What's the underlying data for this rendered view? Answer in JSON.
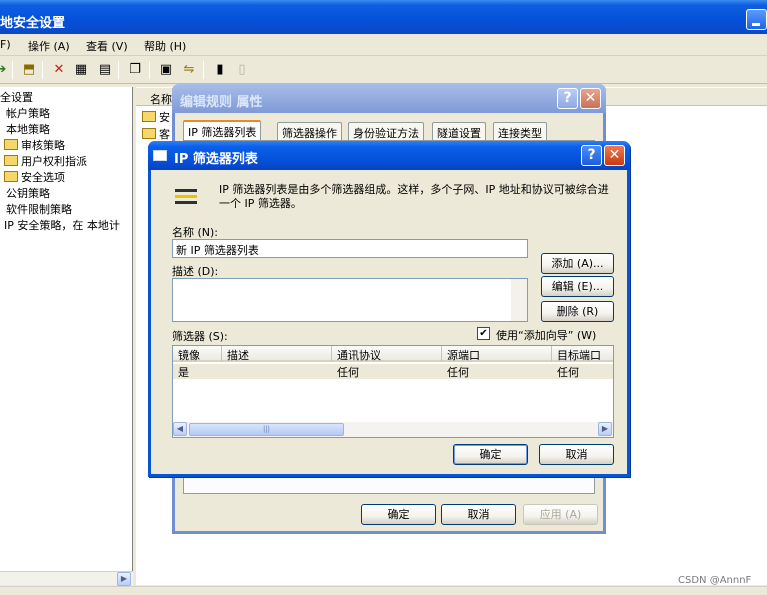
{
  "main_window": {
    "title": "地安全设置",
    "menu": [
      "F)",
      "操作 (A)",
      "查看 (V)",
      "帮助 (H)"
    ]
  },
  "tree": {
    "items": [
      {
        "label": "全设置"
      },
      {
        "label": "帐户策略"
      },
      {
        "label": "本地策略"
      },
      {
        "label": "审核策略"
      },
      {
        "label": "用户权利指派"
      },
      {
        "label": "安全选项"
      },
      {
        "label": "公钥策略"
      },
      {
        "label": "软件限制策略"
      },
      {
        "label": "IP 安全策略，在 本地计"
      }
    ]
  },
  "right_pane": {
    "header": "名称",
    "rows": [
      "安",
      "客"
    ]
  },
  "rule_dialog": {
    "title": "编辑规则 属性",
    "tabs": [
      "IP 筛选器列表",
      "筛选器操作",
      "身份验证方法",
      "隧道设置",
      "连接类型"
    ],
    "ok": "确定",
    "cancel": "取消",
    "apply": "应用 (A)"
  },
  "filter_dialog": {
    "title": "IP 筛选器列表",
    "intro": "IP 筛选器列表是由多个筛选器组成。这样，多个子网、IP 地址和协议可被综合进一个 IP 筛选器。",
    "name_label": "名称 (N):",
    "name_value": "新 IP 筛选器列表",
    "desc_label": "描述 (D):",
    "desc_value": "",
    "add": "添加 (A)...",
    "edit": "编辑 (E)...",
    "remove": "删除 (R)",
    "filters_label": "筛选器 (S):",
    "wizard_label": "使用“添加向导” (W)",
    "wizard_checked": true,
    "columns": [
      "镜像",
      "描述",
      "通讯协议",
      "源端口",
      "目标端口"
    ],
    "rows": [
      {
        "mirror": "是",
        "desc": "",
        "protocol": "任何",
        "src_port": "任何",
        "dst_port": "任何"
      }
    ],
    "ok": "确定",
    "cancel": "取消"
  },
  "watermark": "CSDN @AnnnF"
}
